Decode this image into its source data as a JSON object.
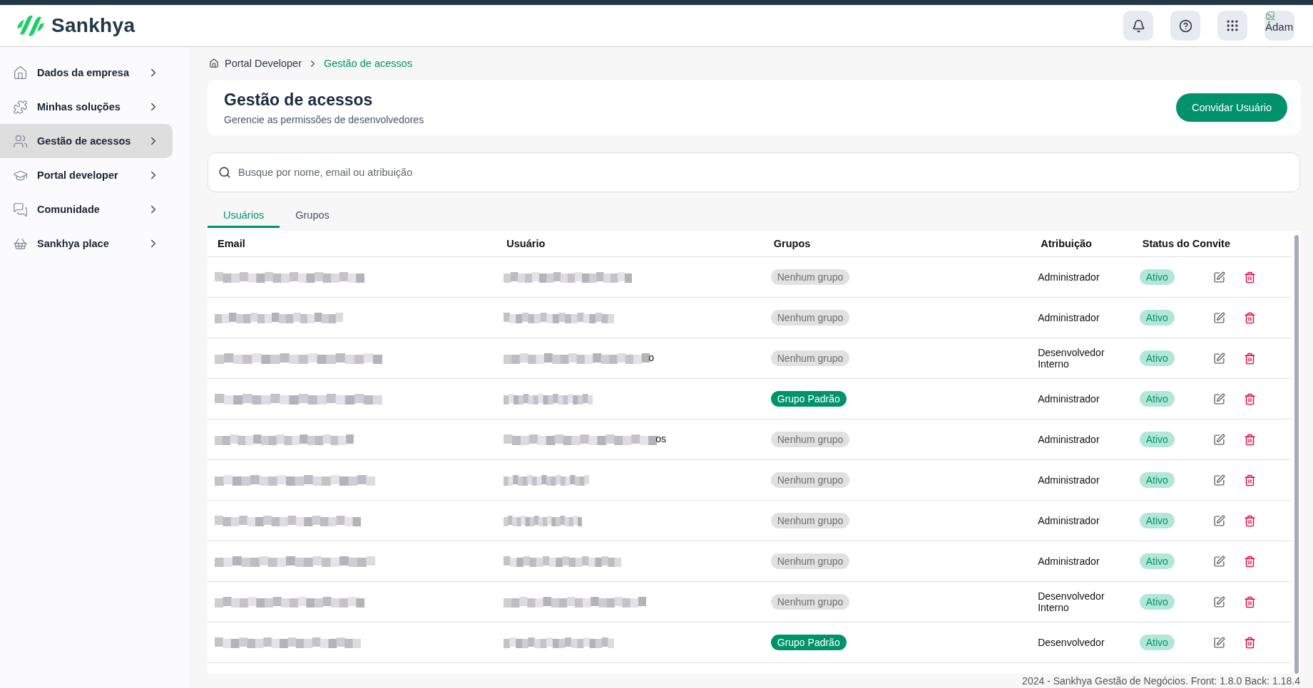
{
  "header": {
    "logo_text": "Sankhya",
    "avatar_alt": "Ádam"
  },
  "sidebar": {
    "items": [
      {
        "label": "Dados da empresa",
        "selected": false
      },
      {
        "label": "Minhas soluções",
        "selected": false
      },
      {
        "label": "Gestão de acessos",
        "selected": true
      },
      {
        "label": "Portal developer",
        "selected": false
      },
      {
        "label": "Comunidade",
        "selected": false
      },
      {
        "label": "Sankhya place",
        "selected": false
      }
    ]
  },
  "breadcrumb": [
    {
      "label": "Portal Developer",
      "selected": false
    },
    {
      "label": "Gestão de acessos",
      "selected": true
    }
  ],
  "page": {
    "title": "Gestão de acessos",
    "subtitle": "Gerencie as permissões de desenvolvedores",
    "invite_button": "Convidar Usuário"
  },
  "search": {
    "placeholder": "Busque por nome, email ou atribuição"
  },
  "tabs": [
    {
      "label": "Usuários",
      "selected": true
    },
    {
      "label": "Grupos",
      "selected": false
    }
  ],
  "table": {
    "columns": [
      "Email",
      "Usuário",
      "Grupos",
      "Atribuição",
      "Status do Convite"
    ],
    "rows": [
      {
        "group": {
          "label": "Nenhum grupo",
          "kind": "none"
        },
        "role": "Administrador",
        "status": {
          "label": "Ativo",
          "kind": "active"
        }
      },
      {
        "group": {
          "label": "Nenhum grupo",
          "kind": "none"
        },
        "role": "Administrador",
        "status": {
          "label": "Ativo",
          "kind": "active"
        }
      },
      {
        "user_tail": "o",
        "group": {
          "label": "Nenhum grupo",
          "kind": "none"
        },
        "role": "Desenvolvedor Interno",
        "status": {
          "label": "Ativo",
          "kind": "active"
        }
      },
      {
        "group": {
          "label": "Grupo Padrão",
          "kind": "default"
        },
        "role": "Administrador",
        "status": {
          "label": "Ativo",
          "kind": "active"
        }
      },
      {
        "user_tail": "os",
        "group": {
          "label": "Nenhum grupo",
          "kind": "none"
        },
        "role": "Administrador",
        "status": {
          "label": "Ativo",
          "kind": "active"
        }
      },
      {
        "group": {
          "label": "Nenhum grupo",
          "kind": "none"
        },
        "role": "Administrador",
        "status": {
          "label": "Ativo",
          "kind": "active"
        }
      },
      {
        "group": {
          "label": "Nenhum grupo",
          "kind": "none"
        },
        "role": "Administrador",
        "status": {
          "label": "Ativo",
          "kind": "active"
        }
      },
      {
        "group": {
          "label": "Nenhum grupo",
          "kind": "none"
        },
        "role": "Administrador",
        "status": {
          "label": "Ativo",
          "kind": "active"
        }
      },
      {
        "group": {
          "label": "Nenhum grupo",
          "kind": "none"
        },
        "role": "Desenvolvedor Interno",
        "status": {
          "label": "Ativo",
          "kind": "active"
        }
      },
      {
        "group": {
          "label": "Grupo Padrão",
          "kind": "default"
        },
        "role": "Desenvolvedor",
        "status": {
          "label": "Ativo",
          "kind": "active"
        }
      }
    ]
  },
  "footer": "2024 - Sankhya Gestão de Negócios. Front: 1.8.0 Back: 1.18.4"
}
